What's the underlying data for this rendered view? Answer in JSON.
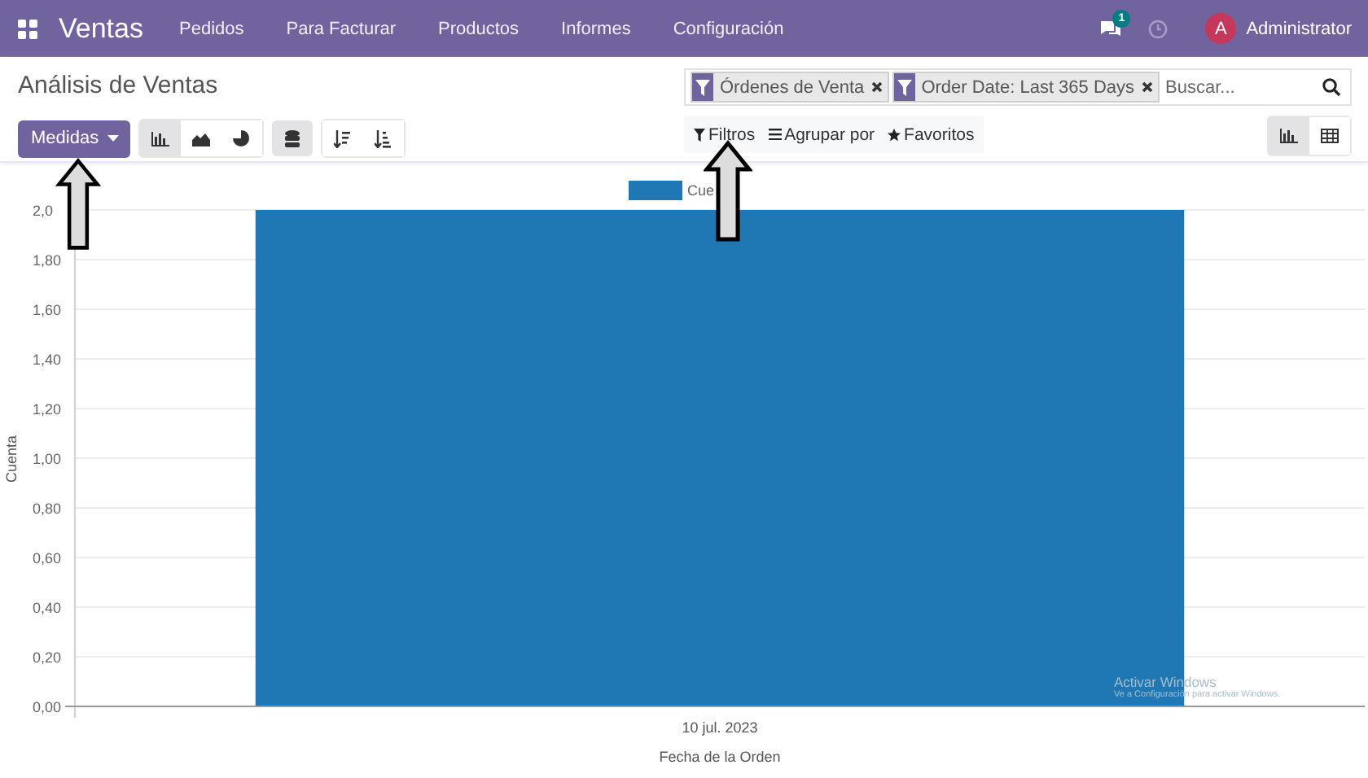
{
  "navbar": {
    "app_name": "Ventas",
    "menu": [
      "Pedidos",
      "Para Facturar",
      "Productos",
      "Informes",
      "Configuración"
    ],
    "messages_badge": "1",
    "user": {
      "initial": "A",
      "name": "Administrator"
    }
  },
  "control_panel": {
    "title": "Análisis de Ventas",
    "search": {
      "facets": [
        {
          "label": "Órdenes de Venta"
        },
        {
          "label": "Order Date: Last 365 Days"
        }
      ],
      "placeholder": "Buscar..."
    },
    "measures_button": "Medidas",
    "chart_types": [
      {
        "kind": "bar",
        "selected": true
      },
      {
        "kind": "line",
        "selected": false
      },
      {
        "kind": "pie",
        "selected": false
      }
    ],
    "stacked": {
      "selected": true
    },
    "sort_buttons": [
      {
        "kind": "descending"
      },
      {
        "kind": "ascending"
      }
    ],
    "search_menus": [
      {
        "kind": "filter",
        "label": "Filtros"
      },
      {
        "kind": "group",
        "label": "Agrupar por"
      },
      {
        "kind": "star",
        "label": "Favoritos"
      }
    ],
    "views": [
      {
        "kind": "graph",
        "selected": true
      },
      {
        "kind": "pivot",
        "selected": false
      }
    ]
  },
  "chart": {
    "chart_data": {
      "type": "bar",
      "xlabel": "Fecha de la Orden",
      "ylabel": "Cuenta",
      "categories": [
        "10 jul. 2023"
      ],
      "series": [
        {
          "name": "Cue",
          "color": "#1f77b4",
          "values": [
            2
          ]
        }
      ],
      "ylim": [
        0,
        2
      ],
      "grid": true,
      "yticks": [
        {
          "value": 0,
          "label": "0,00"
        },
        {
          "value": 0.2,
          "label": "0,20"
        },
        {
          "value": 0.4,
          "label": "0,40"
        },
        {
          "value": 0.6,
          "label": "0,60"
        },
        {
          "value": 0.8,
          "label": "0,80"
        },
        {
          "value": 1,
          "label": "1,00"
        },
        {
          "value": 1.2,
          "label": "1,20"
        },
        {
          "value": 1.4,
          "label": "1,40"
        },
        {
          "value": 1.6,
          "label": "1,60"
        },
        {
          "value": 1.8,
          "label": "1,80"
        },
        {
          "value": 2,
          "label": "2,0"
        }
      ]
    }
  },
  "os_notice": {
    "title": "Activar Windows",
    "text": "Ve a Configuración para activar Windows."
  }
}
